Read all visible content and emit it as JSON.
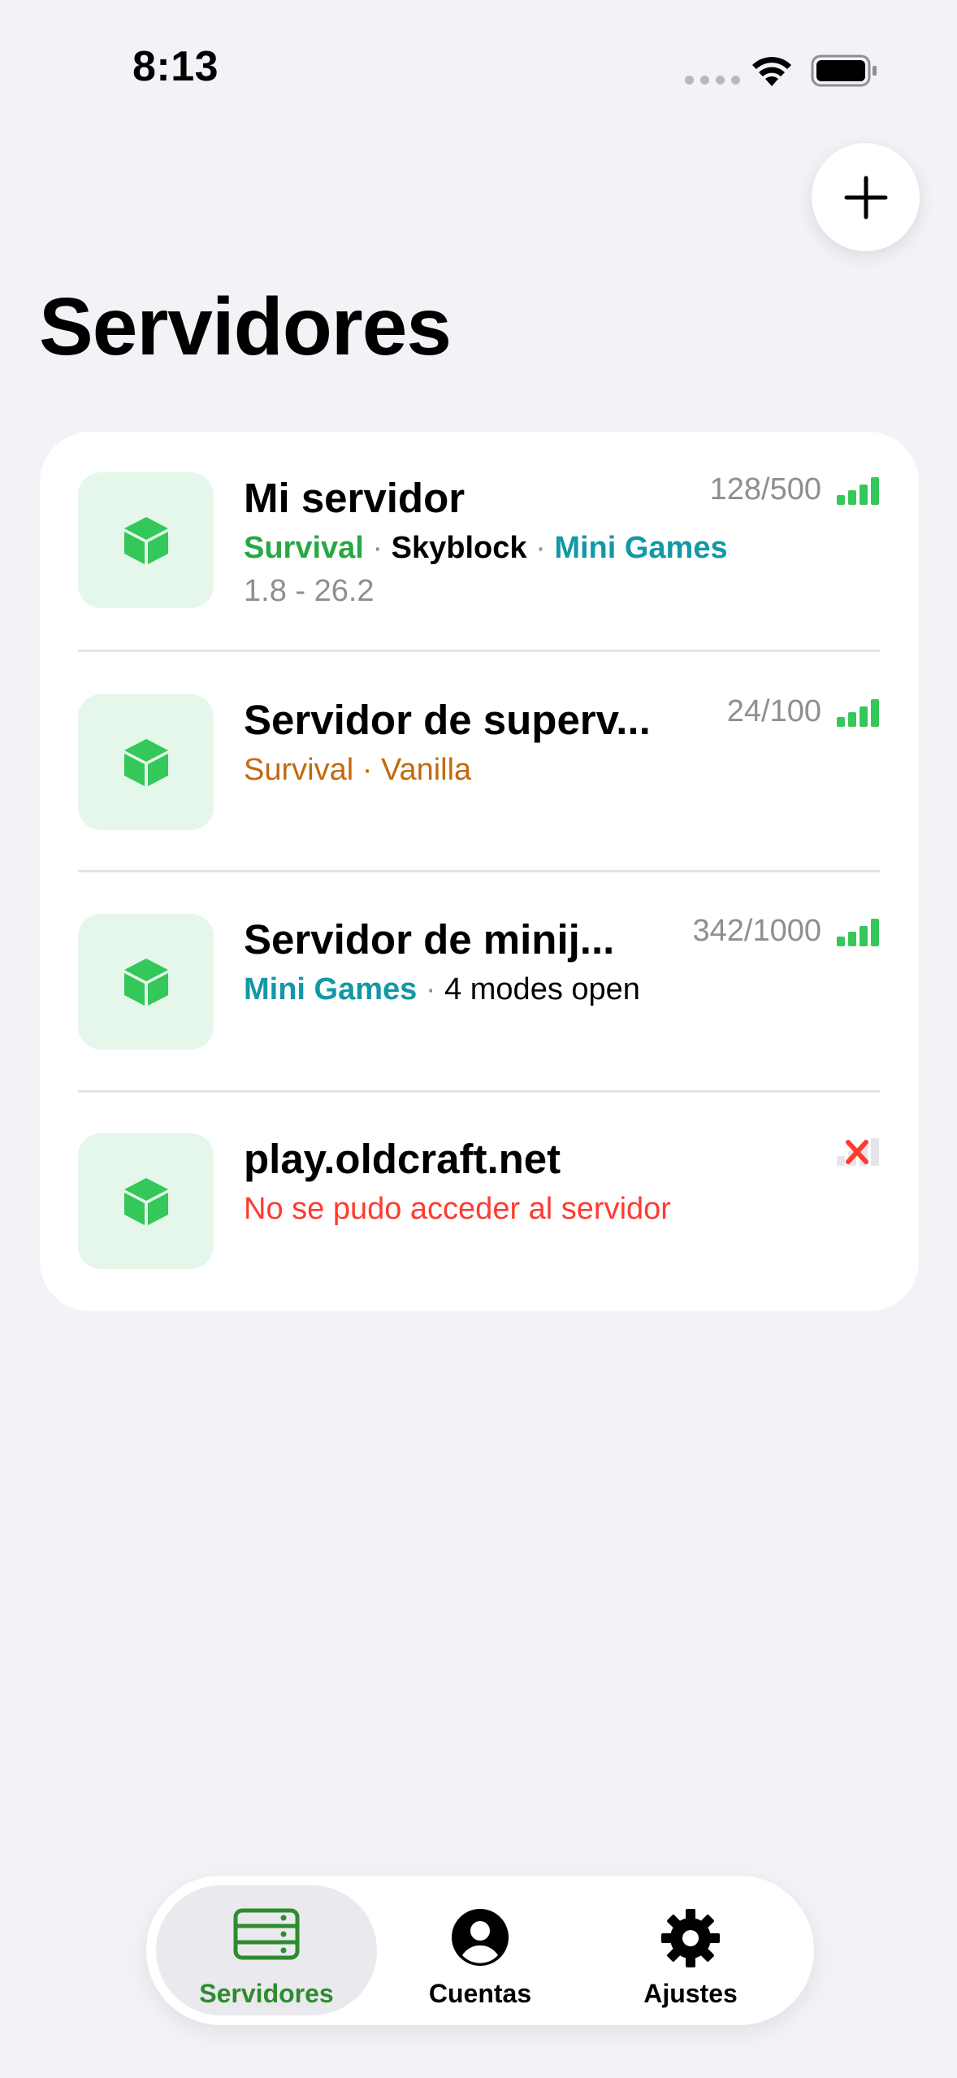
{
  "status_bar": {
    "time": "8:13"
  },
  "page": {
    "title": "Servidores"
  },
  "servers": [
    {
      "name": "Mi servidor",
      "players": "128/500",
      "tags": [
        {
          "text": "Survival",
          "color": "#27a845"
        },
        {
          "text": "Skyblock",
          "color": "#000000"
        },
        {
          "text": "Mini Games",
          "color": "#1298a6"
        }
      ],
      "version": "1.8 - 26.2"
    },
    {
      "name": "Servidor de superv...",
      "players": "24/100",
      "tags": [
        {
          "text": "Survival",
          "color": "#c26a0e"
        },
        {
          "text": "Vanilla",
          "color": "#c26a0e"
        }
      ]
    },
    {
      "name": "Servidor de minij...",
      "players": "342/1000",
      "tags": [
        {
          "text": "Mini Games",
          "color": "#1298a6"
        },
        {
          "text": "4 modes open",
          "color": "#000000"
        }
      ]
    },
    {
      "name": "play.oldcraft.net",
      "error": "No se pudo acceder al servidor"
    }
  ],
  "tab_bar": {
    "servers": "Servidores",
    "accounts": "Cuentas",
    "settings": "Ajustes"
  },
  "colors": {
    "accent_green": "#34c759",
    "tab_active_green": "#2e8b2e",
    "error_red": "#ff3b30",
    "icon_bg": "#e5f7ea"
  }
}
